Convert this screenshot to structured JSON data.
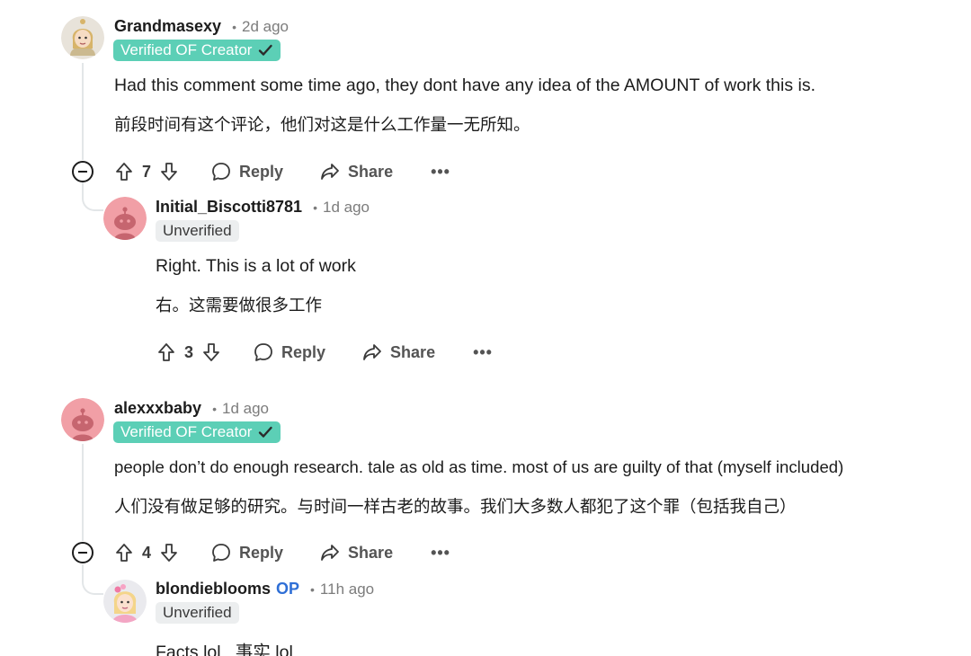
{
  "comments": [
    {
      "username": "Grandmasexy",
      "separator": "•",
      "time": "2d ago",
      "flair": "Verified OF Creator",
      "text_en": "Had this comment some time ago, they dont have any idea of the AMOUNT of work this is.",
      "text_zh": "前段时间有这个评论，他们对这是什么工作量一无所知。",
      "votes": "7",
      "reply_label": "Reply",
      "share_label": "Share",
      "more_label": "•••"
    },
    {
      "username": "Initial_Biscotti8781",
      "separator": "•",
      "time": "1d ago",
      "flair": "Unverified",
      "text_en": "Right. This is a lot of work",
      "text_zh": "右。这需要做很多工作",
      "votes": "3",
      "reply_label": "Reply",
      "share_label": "Share",
      "more_label": "•••"
    },
    {
      "username": "alexxxbaby",
      "separator": "•",
      "time": "1d ago",
      "flair": "Verified OF Creator",
      "text_en": "people don’t do enough research. tale as old as time. most of us are guilty of that (myself included)",
      "text_zh": "人们没有做足够的研究。与时间一样古老的故事。我们大多数人都犯了这个罪（包括我自己）",
      "votes": "4",
      "reply_label": "Reply",
      "share_label": "Share",
      "more_label": "•••"
    },
    {
      "username": "blondieblooms",
      "op_badge": "OP",
      "separator": "•",
      "time": "11h ago",
      "flair": "Unverified",
      "text_mixed": "Facts lol   事实 lol"
    }
  ],
  "colors": {
    "verified_flair": "#5ccfb6",
    "unverified_flair": "#eceeef",
    "op_blue": "#2f6fd6",
    "thread_line": "#e3e6e8"
  }
}
